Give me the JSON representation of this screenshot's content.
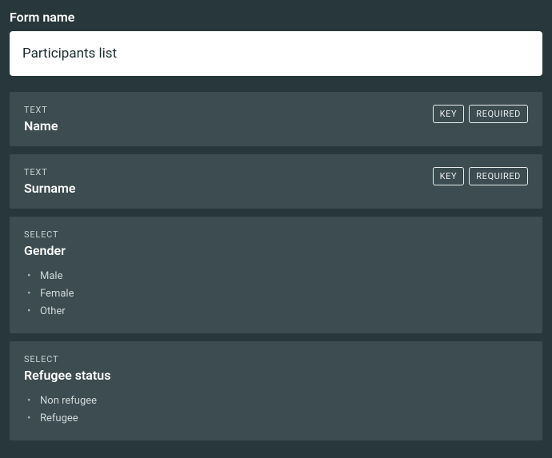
{
  "formNameLabel": "Form name",
  "formNameValue": "Participants list",
  "badges": {
    "key": "KEY",
    "required": "REQUIRED"
  },
  "fields": [
    {
      "type": "TEXT",
      "title": "Name",
      "key": true,
      "required": true,
      "options": []
    },
    {
      "type": "TEXT",
      "title": "Surname",
      "key": true,
      "required": true,
      "options": []
    },
    {
      "type": "SELECT",
      "title": "Gender",
      "key": false,
      "required": false,
      "options": [
        "Male",
        "Female",
        "Other"
      ]
    },
    {
      "type": "SELECT",
      "title": "Refugee status",
      "key": false,
      "required": false,
      "options": [
        "Non refugee",
        "Refugee"
      ]
    }
  ]
}
